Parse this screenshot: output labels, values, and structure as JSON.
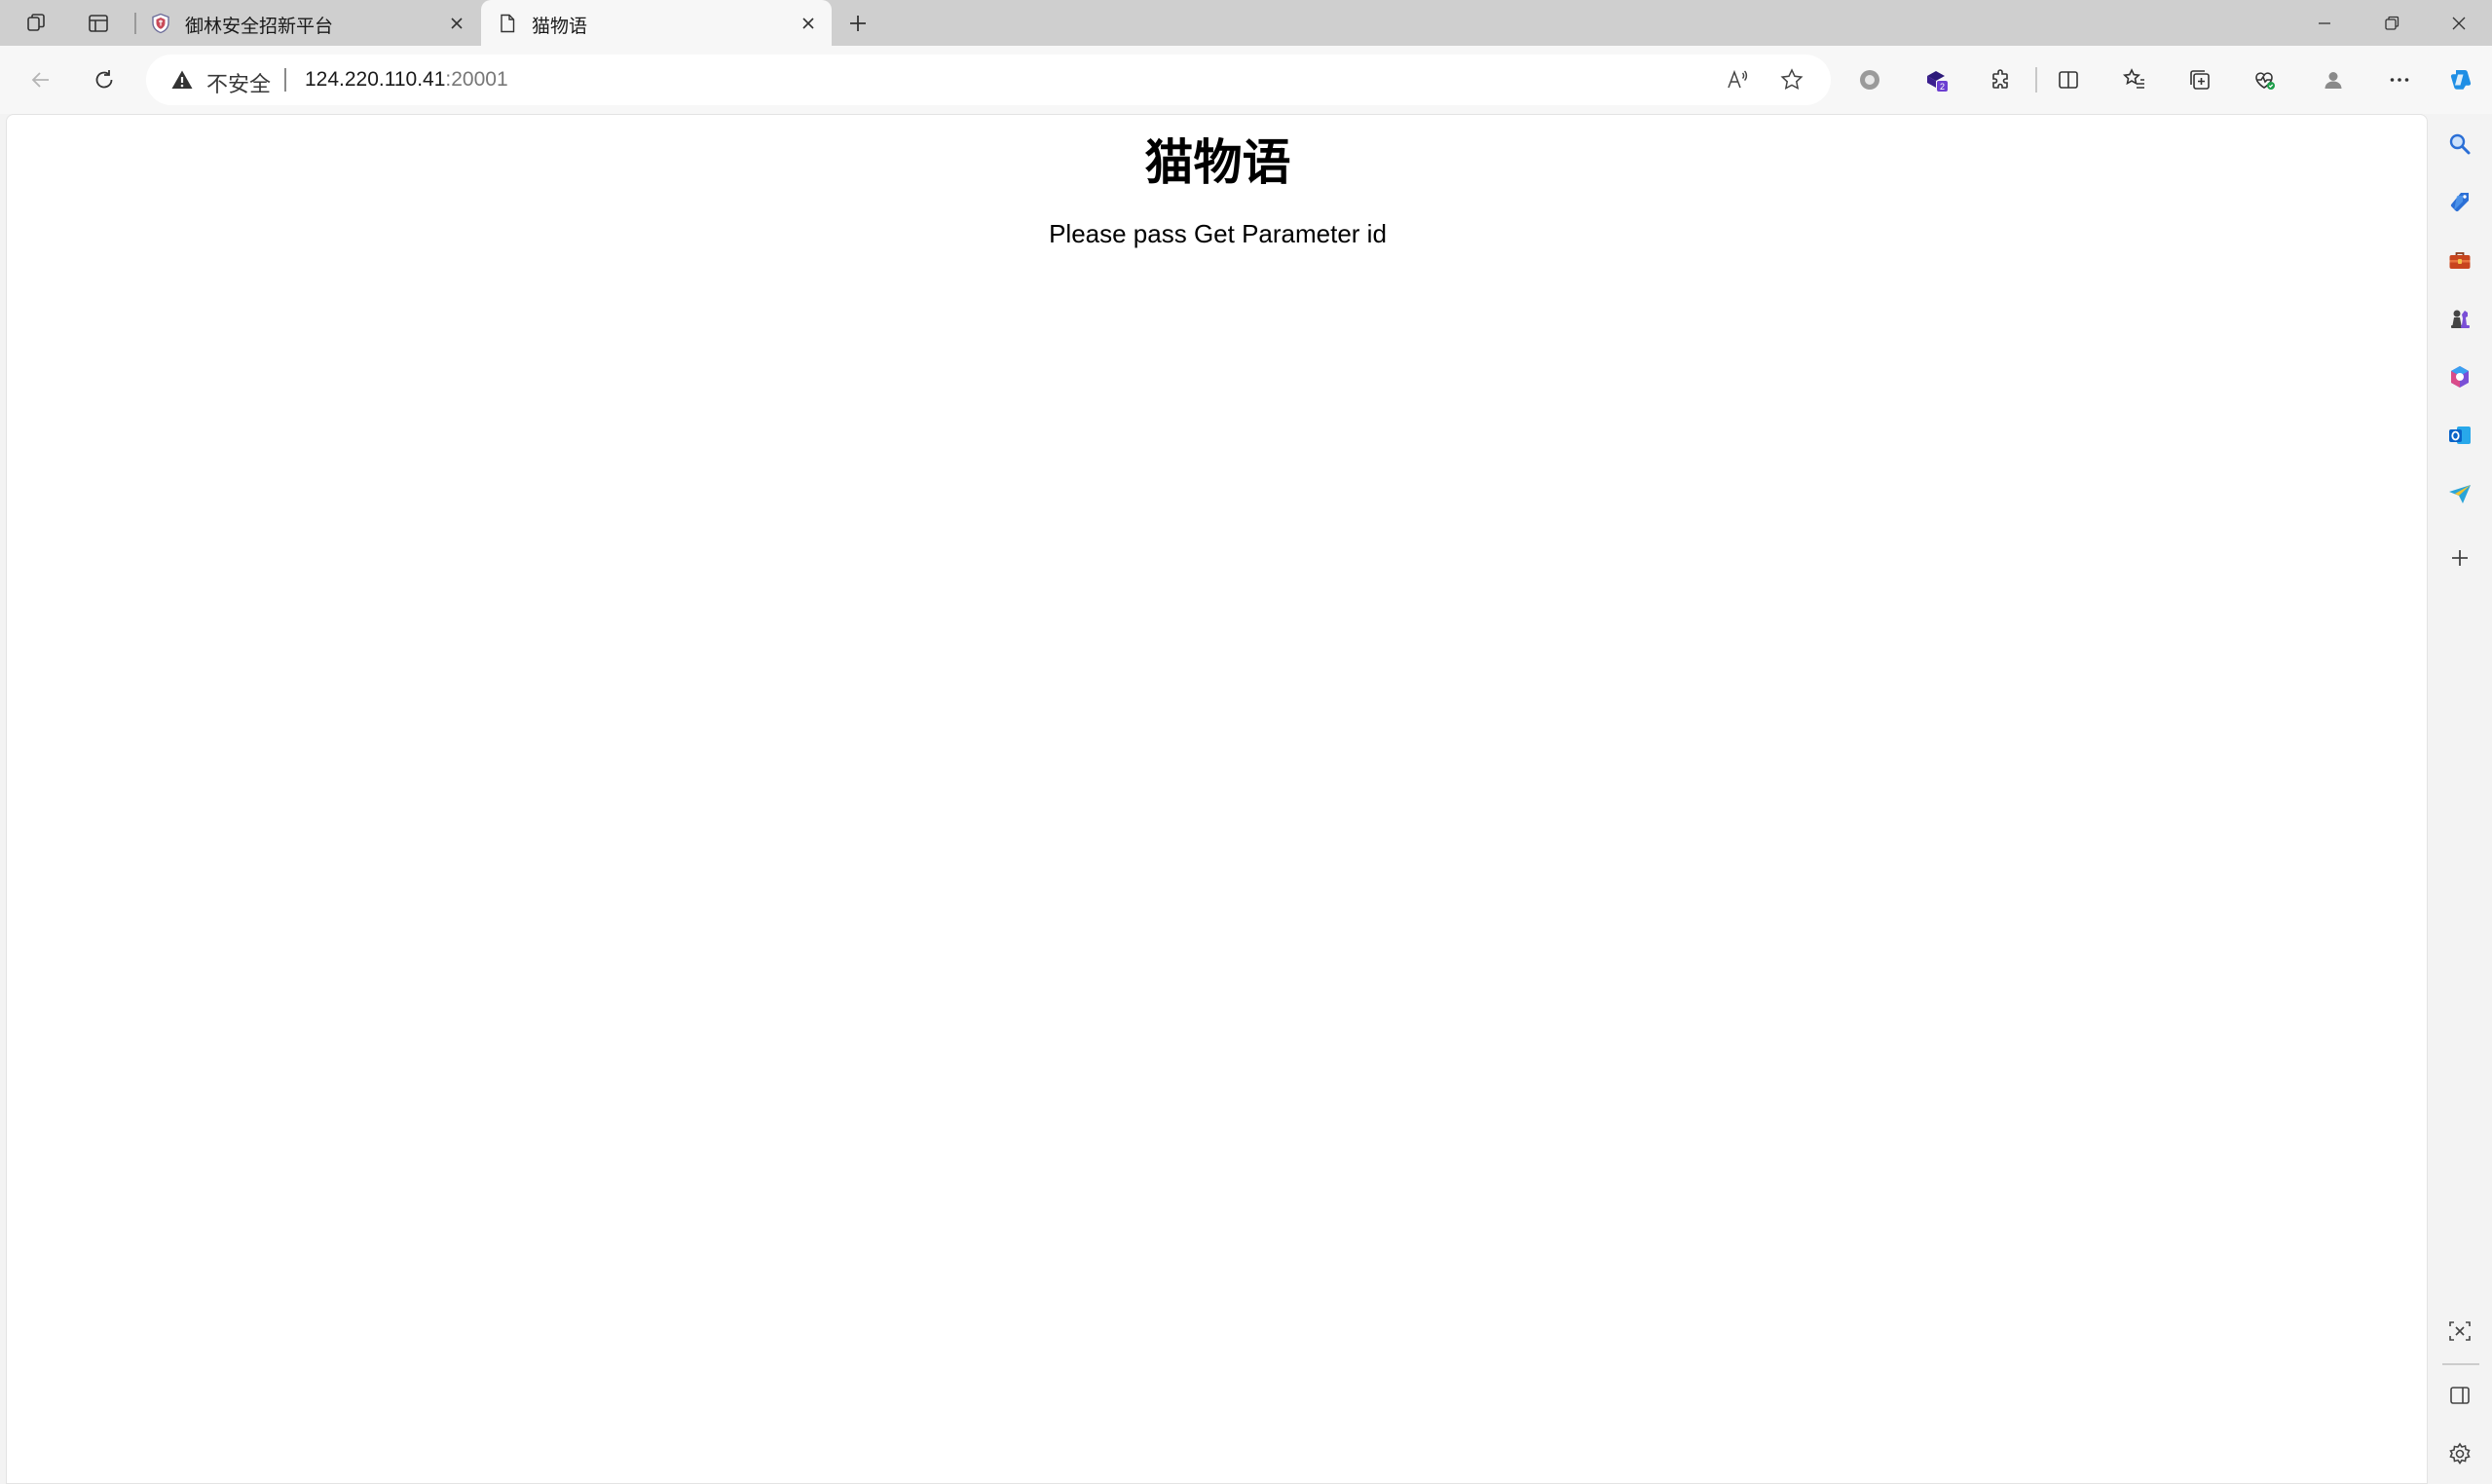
{
  "tabs": [
    {
      "title": "御林安全招新平台",
      "active": false,
      "favicon": "shield-icon"
    },
    {
      "title": "猫物语",
      "active": true,
      "favicon": "document-icon"
    }
  ],
  "address_bar": {
    "security_label": "不安全",
    "url_host": "124.220.110.41",
    "url_port": ":20001"
  },
  "extension_badge": "2",
  "page": {
    "heading": "猫物语",
    "message": "Please pass Get Parameter id"
  },
  "sidebar_items": [
    {
      "name": "search-icon",
      "color": "#2b6fd6"
    },
    {
      "name": "shopping-tag-icon",
      "color": "#2b6fd6"
    },
    {
      "name": "toolbox-icon",
      "color": "#c8451e"
    },
    {
      "name": "chess-icon",
      "color": "#444444"
    },
    {
      "name": "microsoft-365-icon",
      "color": "#7a4fd6"
    },
    {
      "name": "outlook-icon",
      "color": "#0a64c8"
    },
    {
      "name": "send-icon",
      "color": "#2aa4d8"
    },
    {
      "name": "add-icon",
      "color": "#444444"
    }
  ],
  "colors": {
    "tab_strip": "#cfcfcf",
    "toolbar": "#f7f7f7",
    "copilot_accent": "#1f8fe5",
    "extension_accent": "#3b1f8f"
  }
}
